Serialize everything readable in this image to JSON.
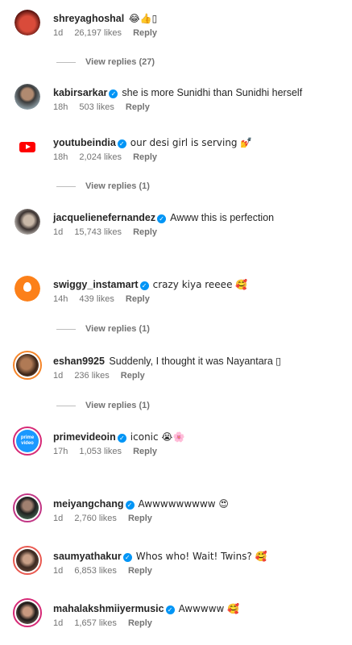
{
  "comments": [
    {
      "username": "shreyaghoshal",
      "verified": false,
      "text": "😂👍▯",
      "time": "1d",
      "likes": "26,197 likes",
      "reply": "Reply",
      "view_replies": "View replies (27)"
    },
    {
      "username": "kabirsarkar",
      "verified": true,
      "text": "she is more Sunidhi than Sunidhi herself",
      "time": "18h",
      "likes": "503 likes",
      "reply": "Reply"
    },
    {
      "username": "youtubeindia",
      "verified": true,
      "text": "our desi girl is serving 💅",
      "time": "18h",
      "likes": "2,024 likes",
      "reply": "Reply",
      "view_replies": "View replies (1)"
    },
    {
      "username": "jacquelienefernandez",
      "verified": true,
      "text": "Awww this is perfection",
      "time": "1d",
      "likes": "15,743 likes",
      "reply": "Reply"
    },
    {
      "username": "swiggy_instamart",
      "verified": true,
      "text": "crazy kiya reeee 🥰",
      "time": "14h",
      "likes": "439 likes",
      "reply": "Reply",
      "view_replies": "View replies (1)"
    },
    {
      "username": "eshan9925",
      "verified": false,
      "text": "Suddenly, I thought it was Nayantara ▯",
      "time": "1d",
      "likes": "236 likes",
      "reply": "Reply",
      "view_replies": "View replies (1)"
    },
    {
      "username": "primevideoin",
      "verified": true,
      "text": "iconic 😭🌸",
      "time": "17h",
      "likes": "1,053 likes",
      "reply": "Reply"
    },
    {
      "username": "meiyangchang",
      "verified": true,
      "text": "Awwwwwwwww 😍",
      "time": "1d",
      "likes": "2,760 likes",
      "reply": "Reply"
    },
    {
      "username": "saumyathakur",
      "verified": true,
      "text": "Whos who! Wait! Twins? 🥰",
      "time": "1d",
      "likes": "6,853 likes",
      "reply": "Reply"
    },
    {
      "username": "mahalakshmiiyermusic",
      "verified": true,
      "text": "Awwwww 🥰",
      "time": "1d",
      "likes": "1,657 likes",
      "reply": "Reply"
    }
  ],
  "colors": {
    "verified": "#0095f6",
    "story_ring": "#e1306c",
    "secondary_text": "#737373"
  },
  "icons": {
    "verified": "verified-badge-icon"
  }
}
